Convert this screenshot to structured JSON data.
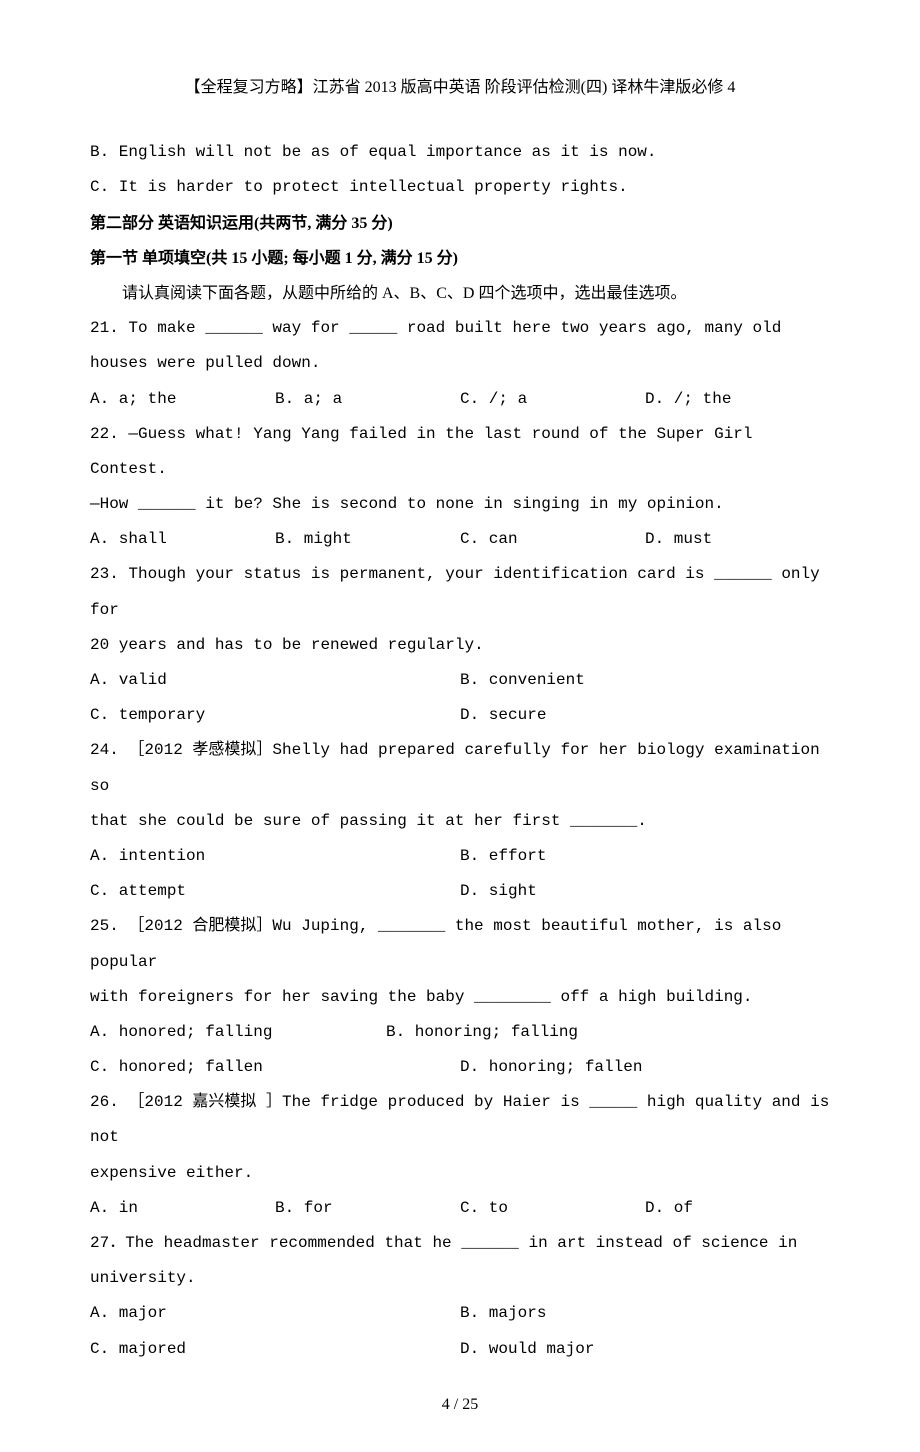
{
  "header": "【全程复习方略】江苏省 2013 版高中英语 阶段评估检测(四) 译林牛津版必修 4",
  "lineB": "B. English will not be as of equal importance as it is now.",
  "lineC": "C. It is harder to protect intellectual property rights.",
  "section2": "第二部分  英语知识运用(共两节, 满分 35 分)",
  "section2sub": "第一节  单项填空(共 15 小题; 每小题 1 分, 满分 15 分)",
  "instructions": "请认真阅读下面各题，从题中所给的 A、B、C、D 四个选项中，选出最佳选项。",
  "q21": {
    "text": "21. To make ______ way for _____ road built here two years ago, many old houses were pulled down.",
    "a": "A. a;  the",
    "b": "B. a;  a",
    "c": "C. /;  a",
    "d": "D. /;  the"
  },
  "q22": {
    "l1": "22. —Guess what!  Yang Yang failed in the last round of the Super Girl Contest.",
    "l2": "—How ______ it be?  She is second to none in singing in my opinion.",
    "a": "A. shall",
    "b": "B. might",
    "c": "C. can",
    "d": "D. must"
  },
  "q23": {
    "l1": "23. Though your status is permanent,  your identification card is ______ only for",
    "l2": "20 years and has to be renewed regularly.",
    "a": "A. valid",
    "b": "B. convenient",
    "c": "C. temporary",
    "d": "D. secure"
  },
  "q24": {
    "l1": "24. ［2012 孝感模拟］Shelly had prepared carefully for her biology examination so",
    "l2": "that she could be sure of passing it at her first _______.",
    "a": "A. intention",
    "b": "B. effort",
    "c": "C. attempt",
    "d": "D. sight"
  },
  "q25": {
    "l1": "25. ［2012 合肥模拟］Wu Juping, _______ the most beautiful mother, is also popular",
    "l2": "with foreigners for her saving the baby ________ off a high building.",
    "a": "A. honored; falling",
    "b": "B. honoring; falling",
    "c": "C. honored; fallen",
    "d": "D. honoring; fallen"
  },
  "q26": {
    "l1": "26. ［2012 嘉兴模拟 ］The fridge produced by Haier is _____ high quality and is not",
    "l2": "expensive either.",
    "a": "A. in",
    "b": "B. for",
    "c": "C. to",
    "d": "D. of"
  },
  "q27": {
    "l1": "27．The headmaster recommended that he ______ in art instead of science in",
    "l2": "university.",
    "a": "A. major",
    "b": "B. majors",
    "c": "C. majored",
    "d": "D. would major"
  },
  "footer": "4 / 25"
}
